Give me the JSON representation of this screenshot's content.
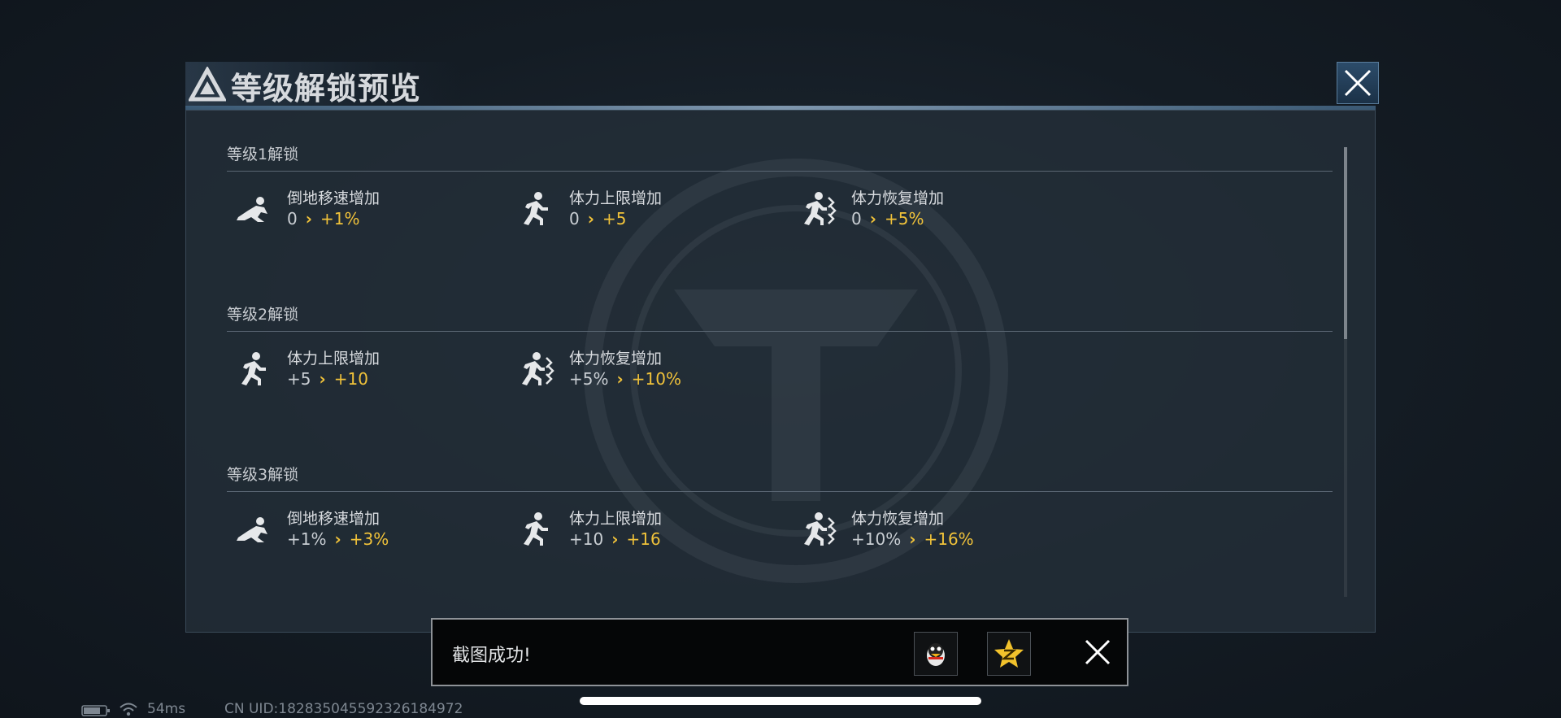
{
  "header": {
    "title": "等级解锁预览"
  },
  "levels": [
    {
      "title": "等级1解锁",
      "perks": [
        {
          "icon": "crawl-icon",
          "name": "倒地移速增加",
          "from": "0",
          "to": "+1%"
        },
        {
          "icon": "run-icon",
          "name": "体力上限增加",
          "from": "0",
          "to": "+5"
        },
        {
          "icon": "sprint-icon",
          "name": "体力恢复增加",
          "from": "0",
          "to": "+5%"
        }
      ]
    },
    {
      "title": "等级2解锁",
      "perks": [
        {
          "icon": "run-icon",
          "name": "体力上限增加",
          "from": "+5",
          "to": "+10"
        },
        {
          "icon": "sprint-icon",
          "name": "体力恢复增加",
          "from": "+5%",
          "to": "+10%"
        }
      ]
    },
    {
      "title": "等级3解锁",
      "perks": [
        {
          "icon": "crawl-icon",
          "name": "倒地移速增加",
          "from": "+1%",
          "to": "+3%"
        },
        {
          "icon": "run-icon",
          "name": "体力上限增加",
          "from": "+10",
          "to": "+16"
        },
        {
          "icon": "sprint-icon",
          "name": "体力恢复增加",
          "from": "+10%",
          "to": "+16%"
        }
      ]
    }
  ],
  "toast": {
    "text": "截图成功!"
  },
  "status": {
    "ping": "54ms",
    "uid": "CN UID:1828350455923261849​72"
  },
  "colors": {
    "accent": "#f0c23a",
    "panel": "#232e38"
  },
  "scroll": {
    "position": 0
  }
}
